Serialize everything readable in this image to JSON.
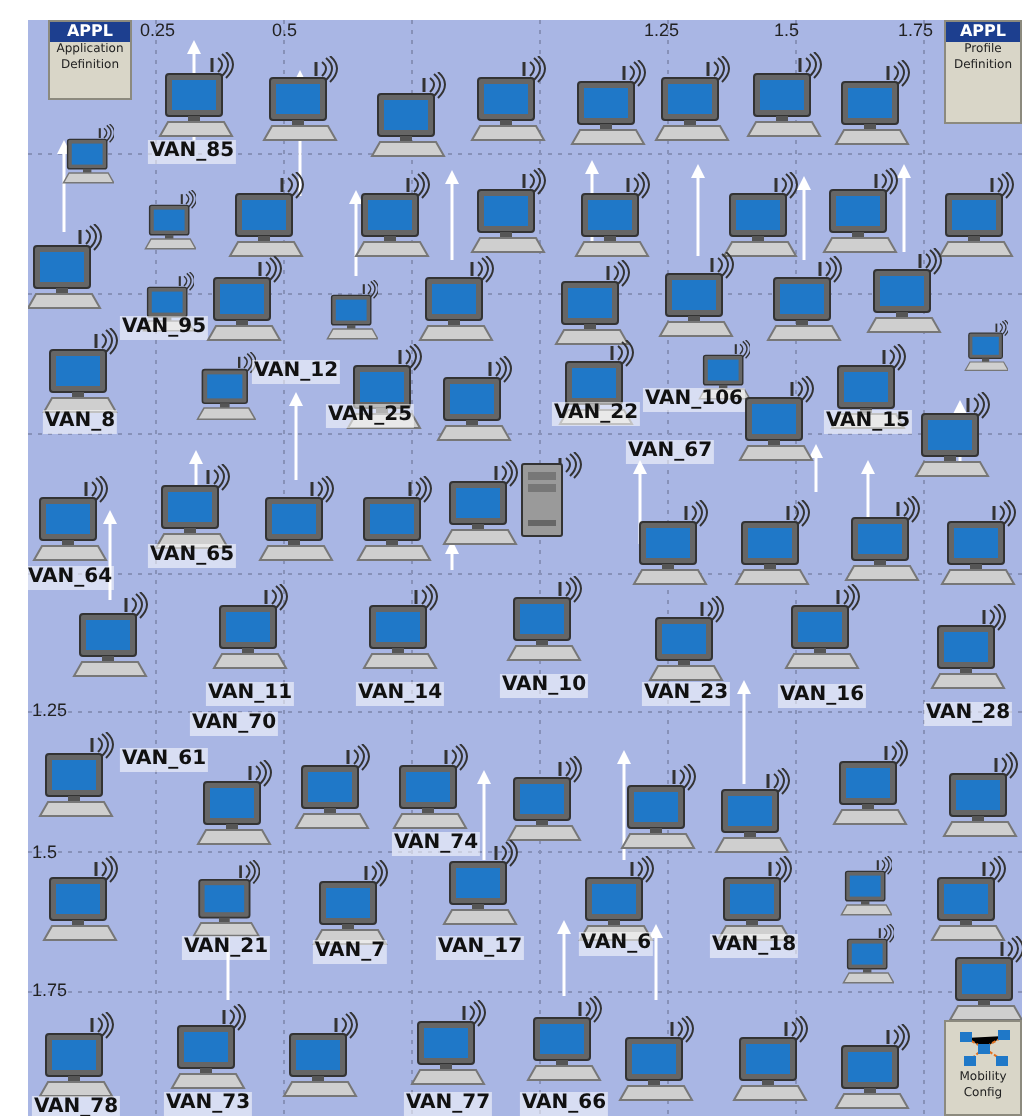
{
  "canvas": {
    "x_ticks": [
      "0.25",
      "0.5",
      "1.25",
      "1.5",
      "1.75"
    ],
    "y_ticks": [
      "1.25",
      "1.5",
      "1.75"
    ]
  },
  "objects": [
    {
      "kind": "config",
      "badge": "APPL",
      "caption": "Application Definition"
    },
    {
      "kind": "config",
      "badge": "APPL",
      "caption": "Profile Definition"
    },
    {
      "kind": "mobility",
      "caption": "Mobility Config"
    }
  ],
  "nodes": [
    {
      "kind": "workstation"
    },
    {
      "kind": "workstation"
    },
    {
      "kind": "workstation"
    },
    {
      "kind": "workstation"
    },
    {
      "kind": "workstation"
    },
    {
      "kind": "workstation"
    },
    {
      "kind": "workstation"
    },
    {
      "kind": "workstation"
    },
    {
      "kind": "workstation"
    },
    {
      "kind": "workstation",
      "label": "VAN_85"
    },
    {
      "kind": "workstation"
    },
    {
      "kind": "workstation"
    },
    {
      "kind": "workstation"
    },
    {
      "kind": "workstation"
    },
    {
      "kind": "workstation"
    },
    {
      "kind": "workstation"
    },
    {
      "kind": "workstation"
    },
    {
      "kind": "workstation"
    },
    {
      "kind": "workstation",
      "label": "VAN_95"
    },
    {
      "kind": "workstation"
    },
    {
      "kind": "workstation"
    },
    {
      "kind": "workstation"
    },
    {
      "kind": "workstation"
    },
    {
      "kind": "workstation"
    },
    {
      "kind": "workstation"
    },
    {
      "kind": "workstation"
    },
    {
      "kind": "workstation"
    },
    {
      "kind": "workstation",
      "label": "VAN_8"
    },
    {
      "kind": "workstation",
      "label": "VAN_12"
    },
    {
      "kind": "workstation",
      "label": "VAN_25"
    },
    {
      "kind": "workstation"
    },
    {
      "kind": "workstation",
      "label": "VAN_22"
    },
    {
      "kind": "workstation"
    },
    {
      "kind": "workstation",
      "label": "VAN_106"
    },
    {
      "kind": "workstation",
      "label": "VAN_15"
    },
    {
      "kind": "workstation"
    },
    {
      "kind": "workstation",
      "label": "VAN_64"
    },
    {
      "kind": "workstation",
      "label": "VAN_65"
    },
    {
      "kind": "workstation"
    },
    {
      "kind": "workstation"
    },
    {
      "kind": "workstation"
    },
    {
      "kind": "server"
    },
    {
      "kind": "workstation",
      "label": "VAN_67"
    },
    {
      "kind": "workstation"
    },
    {
      "kind": "workstation"
    },
    {
      "kind": "workstation"
    },
    {
      "kind": "workstation"
    },
    {
      "kind": "workstation",
      "label": "VAN_11"
    },
    {
      "kind": "workstation",
      "label": "VAN_14"
    },
    {
      "kind": "workstation",
      "label": "VAN_10"
    },
    {
      "kind": "workstation",
      "label": "VAN_23"
    },
    {
      "kind": "workstation",
      "label": "VAN_16"
    },
    {
      "kind": "workstation",
      "label": "VAN_28"
    },
    {
      "kind": "workstation",
      "label": "VAN_61"
    },
    {
      "kind": "workstation",
      "label": "VAN_70"
    },
    {
      "kind": "workstation"
    },
    {
      "kind": "workstation",
      "label": "VAN_74"
    },
    {
      "kind": "workstation"
    },
    {
      "kind": "workstation"
    },
    {
      "kind": "workstation"
    },
    {
      "kind": "workstation"
    },
    {
      "kind": "workstation"
    },
    {
      "kind": "workstation"
    },
    {
      "kind": "workstation",
      "label": "VAN_21"
    },
    {
      "kind": "workstation",
      "label": "VAN_7"
    },
    {
      "kind": "workstation",
      "label": "VAN_17"
    },
    {
      "kind": "workstation",
      "label": "VAN_6"
    },
    {
      "kind": "workstation",
      "label": "VAN_18"
    },
    {
      "kind": "workstation"
    },
    {
      "kind": "workstation"
    },
    {
      "kind": "workstation"
    },
    {
      "kind": "workstation",
      "label": "VAN_78"
    },
    {
      "kind": "workstation",
      "label": "VAN_73"
    },
    {
      "kind": "workstation"
    },
    {
      "kind": "workstation",
      "label": "VAN_77"
    },
    {
      "kind": "workstation",
      "label": "VAN_66"
    },
    {
      "kind": "workstation"
    },
    {
      "kind": "workstation"
    },
    {
      "kind": "workstation"
    },
    {
      "kind": "workstation"
    }
  ]
}
